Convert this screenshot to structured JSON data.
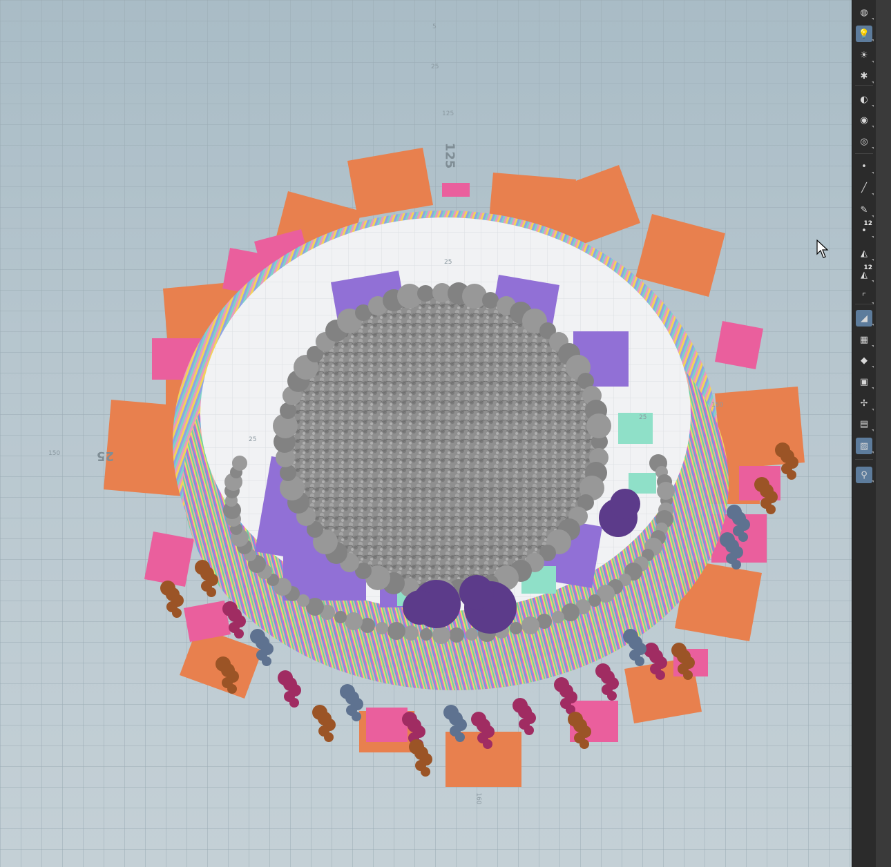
{
  "viewport": {
    "grid_labels": [
      "5",
      "25",
      "25",
      "25",
      "25",
      "150",
      "160",
      "150",
      "125"
    ],
    "big_labels": [
      "25",
      "125"
    ]
  },
  "toolbar": {
    "items": [
      {
        "icon": "display-sphere-icon",
        "label": ""
      },
      {
        "icon": "lightbulb-icon",
        "label": "",
        "active": true
      },
      {
        "icon": "headlight-icon",
        "label": ""
      },
      {
        "icon": "light-rig-icon",
        "label": ""
      },
      {
        "icon": "shading-ball-icon",
        "label": ""
      },
      {
        "icon": "eye-visibility-icon",
        "label": ""
      },
      {
        "icon": "camera-eye-icon",
        "label": ""
      },
      {
        "icon": "point-icon",
        "label": ""
      },
      {
        "icon": "normal-line-icon",
        "label": ""
      },
      {
        "icon": "pen-icon",
        "label": ""
      },
      {
        "icon": "point-number-icon",
        "label": "12"
      },
      {
        "icon": "prim-icon",
        "label": ""
      },
      {
        "icon": "prim-number-icon",
        "label": "12"
      },
      {
        "icon": "bounding-corner-icon",
        "label": ""
      },
      {
        "icon": "wire-shaded-icon",
        "label": "",
        "active": true
      },
      {
        "icon": "checker-icon",
        "label": ""
      },
      {
        "icon": "layer-diamond-icon",
        "label": ""
      },
      {
        "icon": "uv-green-icon",
        "label": ""
      },
      {
        "icon": "axis-icon",
        "label": ""
      },
      {
        "icon": "film-icon",
        "label": ""
      },
      {
        "icon": "background-image-icon",
        "label": "",
        "active": true
      },
      {
        "icon": "location-pin-icon",
        "label": "",
        "active": true
      }
    ]
  },
  "colors": {
    "orange": "#e8804e",
    "pink": "#ea5f9d",
    "purple": "#9170d6",
    "dark_purple": "#5c3b8a",
    "gray": "#8d8d8d",
    "white": "#f1f2f4",
    "brown": "#9b5426",
    "magenta": "#a02c62",
    "slate": "#5e7290",
    "mint": "#8fe0c8",
    "toolbar_bg": "#2b2b2b",
    "active_btn": "#5d7c9c"
  }
}
